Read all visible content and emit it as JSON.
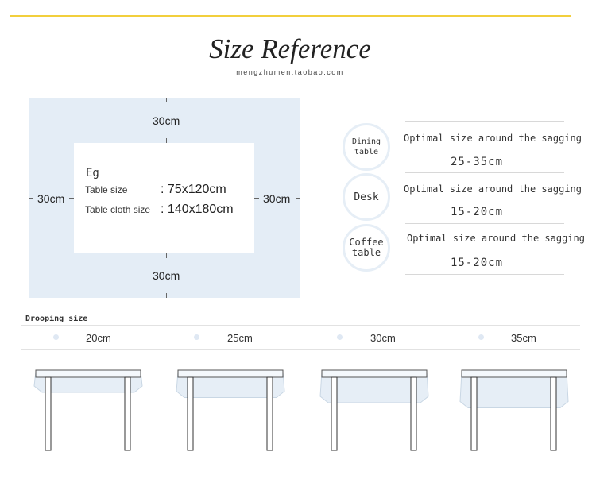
{
  "header": {
    "title": "Size Reference",
    "subtitle": "mengzhumen.taobao.com"
  },
  "diagram": {
    "top": "30cm",
    "bottom": "30cm",
    "left": "30cm",
    "right": "30cm",
    "eg": "Eg",
    "table_size_label": "Table size",
    "table_size_value": ": 75x120cm",
    "cloth_size_label": "Table cloth size",
    "cloth_size_value": ": 140x180cm"
  },
  "recommendations": [
    {
      "name_line1": "Dining",
      "name_line2": "table",
      "text": "Optimal size around the sagging",
      "range": "25-35cm"
    },
    {
      "name_line1": "Desk",
      "name_line2": "",
      "text": "Optimal size around the sagging",
      "range": "15-20cm"
    },
    {
      "name_line1": "Coffee",
      "name_line2": "table",
      "text": "Optimal size around the sagging",
      "range": "15-20cm"
    }
  ],
  "drooping": {
    "title": "Drooping size",
    "sizes": [
      {
        "label": "20cm",
        "value": 20
      },
      {
        "label": "25cm",
        "value": 25
      },
      {
        "label": "30cm",
        "value": 30
      },
      {
        "label": "35cm",
        "value": 35
      }
    ]
  },
  "colors": {
    "accent_line": "#f2cf3c",
    "cloth_blue": "#e4edf6",
    "leg": "#333333"
  }
}
